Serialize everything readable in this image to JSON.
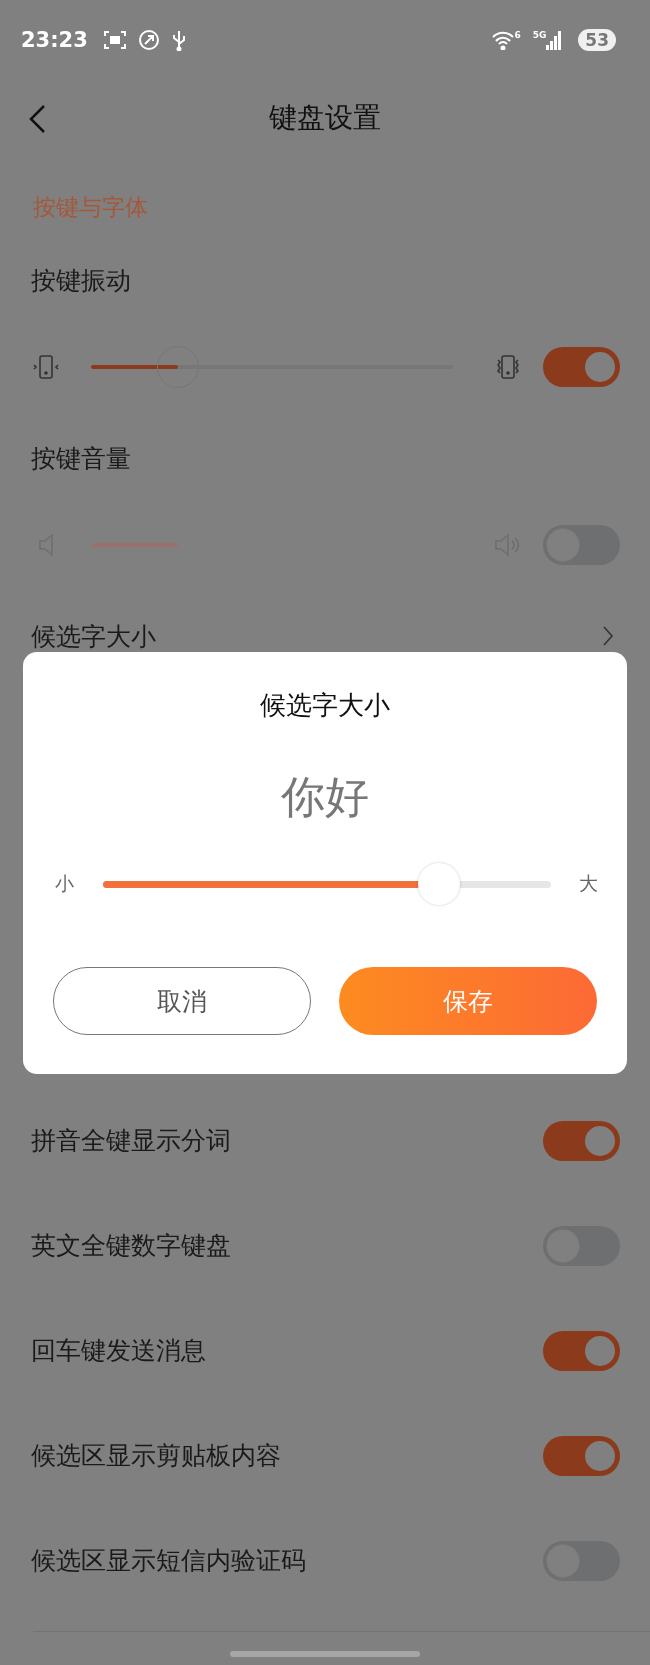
{
  "status_bar": {
    "time": "23:23",
    "wifi_badge": "6",
    "network": "5G",
    "battery": "53"
  },
  "header": {
    "title": "键盘设置"
  },
  "section": {
    "title": "按键与字体"
  },
  "rows": [
    {
      "kind": "vibration",
      "label": "按键振动",
      "level": 0.24,
      "on": true,
      "disabled": false
    },
    {
      "kind": "volume",
      "label": "按键音量",
      "level": 0.24,
      "on": false,
      "disabled": true
    },
    {
      "kind": "link",
      "label": "候选字大小"
    },
    {
      "kind": "toggle",
      "label": "拼音全键显示分词",
      "on": true
    },
    {
      "kind": "toggle",
      "label": "英文全键数字键盘",
      "on": false
    },
    {
      "kind": "toggle",
      "label": "回车键发送消息",
      "on": true
    },
    {
      "kind": "toggle",
      "label": "候选区显示剪贴板内容",
      "on": true
    },
    {
      "kind": "toggle",
      "label": "候选区显示短信内验证码",
      "on": false
    }
  ],
  "dialog": {
    "title": "候选字大小",
    "preview": "你好",
    "min_label": "小",
    "max_label": "大",
    "level": 0.75,
    "buttons": [
      {
        "label": "取消",
        "kind": "secondary"
      },
      {
        "label": "保存",
        "kind": "primary"
      }
    ]
  }
}
